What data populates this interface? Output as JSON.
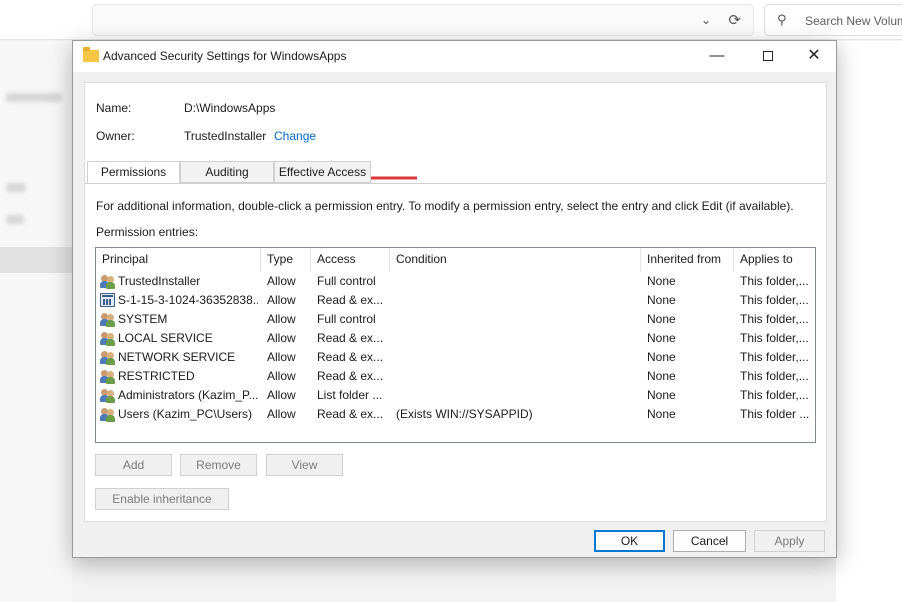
{
  "explorer": {
    "search_placeholder": "Search New Volume"
  },
  "dialog": {
    "title": "Advanced Security Settings for WindowsApps",
    "name_label": "Name:",
    "name_value": "D:\\WindowsApps",
    "owner_label": "Owner:",
    "owner_value": "TrustedInstaller",
    "change_link": "Change",
    "tabs": [
      "Permissions",
      "Auditing",
      "Effective Access"
    ],
    "info_text": "For additional information, double-click a permission entry. To modify a permission entry, select the entry and click Edit (if available).",
    "entries_label": "Permission entries:",
    "columns": [
      "Principal",
      "Type",
      "Access",
      "Condition",
      "Inherited from",
      "Applies to"
    ],
    "rows": [
      {
        "principal": "TrustedInstaller",
        "type": "Allow",
        "access": "Full control",
        "condition": "",
        "inherited": "None",
        "applies": "This folder,..."
      },
      {
        "principal": "S-1-15-3-1024-36352838...",
        "type": "Allow",
        "access": "Read & ex...",
        "condition": "",
        "inherited": "None",
        "applies": "This folder,..."
      },
      {
        "principal": "SYSTEM",
        "type": "Allow",
        "access": "Full control",
        "condition": "",
        "inherited": "None",
        "applies": "This folder,..."
      },
      {
        "principal": "LOCAL SERVICE",
        "type": "Allow",
        "access": "Read & ex...",
        "condition": "",
        "inherited": "None",
        "applies": "This folder,..."
      },
      {
        "principal": "NETWORK SERVICE",
        "type": "Allow",
        "access": "Read & ex...",
        "condition": "",
        "inherited": "None",
        "applies": "This folder,..."
      },
      {
        "principal": "RESTRICTED",
        "type": "Allow",
        "access": "Read & ex...",
        "condition": "",
        "inherited": "None",
        "applies": "This folder,..."
      },
      {
        "principal": "Administrators (Kazim_P...",
        "type": "Allow",
        "access": "List folder ...",
        "condition": "",
        "inherited": "None",
        "applies": "This folder,..."
      },
      {
        "principal": "Users (Kazim_PC\\Users)",
        "type": "Allow",
        "access": "Read & ex...",
        "condition": "(Exists WIN://SYSAPPID)",
        "inherited": "None",
        "applies": "This folder ..."
      }
    ],
    "buttons": {
      "add": "Add",
      "remove": "Remove",
      "view": "View",
      "enable_inheritance": "Enable inheritance",
      "ok": "OK",
      "cancel": "Cancel",
      "apply": "Apply"
    }
  },
  "colors": {
    "link": "#0066cc",
    "arrow": "#d9363e",
    "focus_border": "#0078d4"
  }
}
